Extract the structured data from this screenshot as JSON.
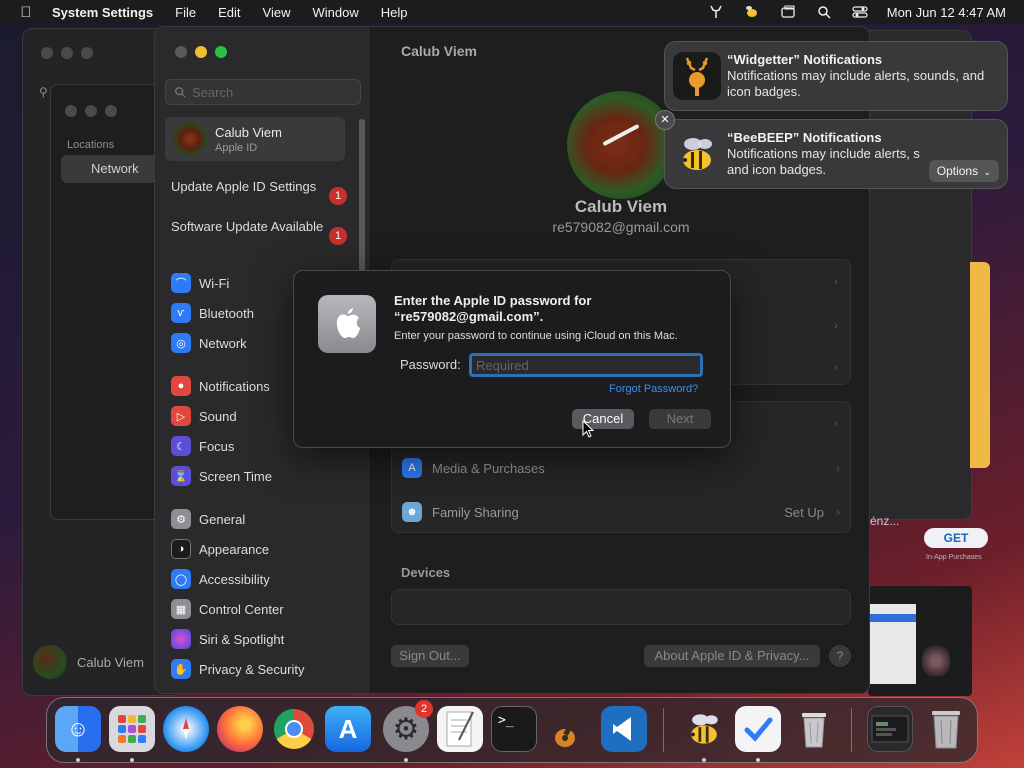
{
  "menubar": {
    "app_name": "System Settings",
    "menus": [
      "File",
      "Edit",
      "View",
      "Window",
      "Help"
    ],
    "datetime": "Mon Jun 12  4:47 AM"
  },
  "background_window": {
    "locations_label": "Locations",
    "network_label": "Network",
    "user_label": "Calub Viem"
  },
  "appstore_fragment": {
    "truncated_text": "énz...",
    "get_label": "GET",
    "iap_label": "In-App Purchases"
  },
  "sidebar": {
    "search_placeholder": "Search",
    "account": {
      "name": "Calub Viem",
      "subtitle": "Apple ID"
    },
    "alerts": [
      {
        "label": "Update Apple ID Settings",
        "badge": "1"
      },
      {
        "label": "Software Update Available",
        "badge": "1"
      }
    ],
    "groups": [
      [
        {
          "label": "Wi-Fi",
          "icon": "wifi-icon",
          "color": "#2f7bf5"
        },
        {
          "label": "Bluetooth",
          "icon": "bluetooth-icon",
          "color": "#2f7bf5"
        },
        {
          "label": "Network",
          "icon": "globe-icon",
          "color": "#2f7bf5"
        }
      ],
      [
        {
          "label": "Notifications",
          "icon": "bell-icon",
          "color": "#e0483e"
        },
        {
          "label": "Sound",
          "icon": "speaker-icon",
          "color": "#e0483e"
        },
        {
          "label": "Focus",
          "icon": "moon-icon",
          "color": "#5b4fd6"
        },
        {
          "label": "Screen Time",
          "icon": "hourglass-icon",
          "color": "#5b4fd6"
        }
      ],
      [
        {
          "label": "General",
          "icon": "gear-icon",
          "color": "#8e8e93"
        },
        {
          "label": "Appearance",
          "icon": "appearance-icon",
          "color": "#1c1c1e"
        },
        {
          "label": "Accessibility",
          "icon": "accessibility-icon",
          "color": "#2f7bf5"
        },
        {
          "label": "Control Center",
          "icon": "control-center-icon",
          "color": "#8e8e93"
        },
        {
          "label": "Siri & Spotlight",
          "icon": "siri-icon",
          "color": "#b04fd6"
        },
        {
          "label": "Privacy & Security",
          "icon": "hand-icon",
          "color": "#2f7bf5"
        }
      ]
    ]
  },
  "content": {
    "title": "Calub Viem",
    "profile_name": "Calub Viem",
    "profile_email": "re579082@gmail.com",
    "rows": [
      {
        "label": "Media & Purchases",
        "icon": "media-purchases-icon",
        "color": "#2f7bf5",
        "value": ""
      },
      {
        "label": "Family Sharing",
        "icon": "family-sharing-icon",
        "color": "#6ea6d6",
        "value": "Set Up"
      }
    ],
    "devices_title": "Devices",
    "sign_out_label": "Sign Out...",
    "about_label": "About Apple ID & Privacy...",
    "help_label": "?"
  },
  "dialog": {
    "title": "Enter the Apple ID password for “re579082@gmail.com”.",
    "subtitle": "Enter your password to continue using iCloud on this Mac.",
    "password_label": "Password:",
    "password_placeholder": "Required",
    "forgot_label": "Forgot Password?",
    "cancel_label": "Cancel",
    "next_label": "Next"
  },
  "notifications": [
    {
      "title": "“Widgetter” Notifications",
      "body": "Notifications may include alerts, sounds, and icon badges.",
      "icon": "widgetter-deer-icon"
    },
    {
      "title": "“BeeBEEP” Notifications",
      "body": "Notifications may include alerts, s",
      "body2": "and icon badges.",
      "icon": "beebeep-bee-icon",
      "options_label": "Options"
    }
  ],
  "dock": {
    "apps": [
      {
        "name": "finder",
        "color": "#2a8df5",
        "glyph": "☺",
        "running": true
      },
      {
        "name": "launchpad",
        "color": "#c9c9d0",
        "glyph": "▦",
        "running": true
      },
      {
        "name": "safari",
        "color": "#1e8cf0",
        "glyph": "⌖",
        "running": false
      },
      {
        "name": "firefox",
        "color": "#ff7139",
        "glyph": "◉",
        "running": false
      },
      {
        "name": "chrome",
        "color": "#e8e8e8",
        "glyph": "◎",
        "running": false
      },
      {
        "name": "app-store",
        "color": "#1e8cf0",
        "glyph": "A",
        "running": false
      },
      {
        "name": "system-settings",
        "color": "#8a8a8e",
        "glyph": "⚙",
        "running": true,
        "badge": "2"
      },
      {
        "name": "textedit",
        "color": "#f2f2f2",
        "glyph": "✎",
        "running": false
      },
      {
        "name": "terminal",
        "color": "#1a1a1a",
        "glyph": ">_",
        "running": false
      },
      {
        "name": "garageband",
        "color": "#4a3a2a",
        "glyph": "♫",
        "running": false
      },
      {
        "name": "vscode",
        "color": "#1f6fc0",
        "glyph": "❯",
        "running": false
      },
      {
        "name": "beebeep",
        "color": "transparent",
        "glyph": "●",
        "running": true
      },
      {
        "name": "tasks",
        "color": "#f2f2f2",
        "glyph": "✔",
        "running": true
      },
      {
        "name": "trash-full",
        "color": "#d0d0d4",
        "glyph": "▯",
        "running": false
      },
      {
        "name": "minimized-window",
        "color": "#2a2a2c",
        "glyph": "▤",
        "running": false
      },
      {
        "name": "trash",
        "color": "#bdbdc2",
        "glyph": "▯",
        "running": false
      }
    ]
  }
}
